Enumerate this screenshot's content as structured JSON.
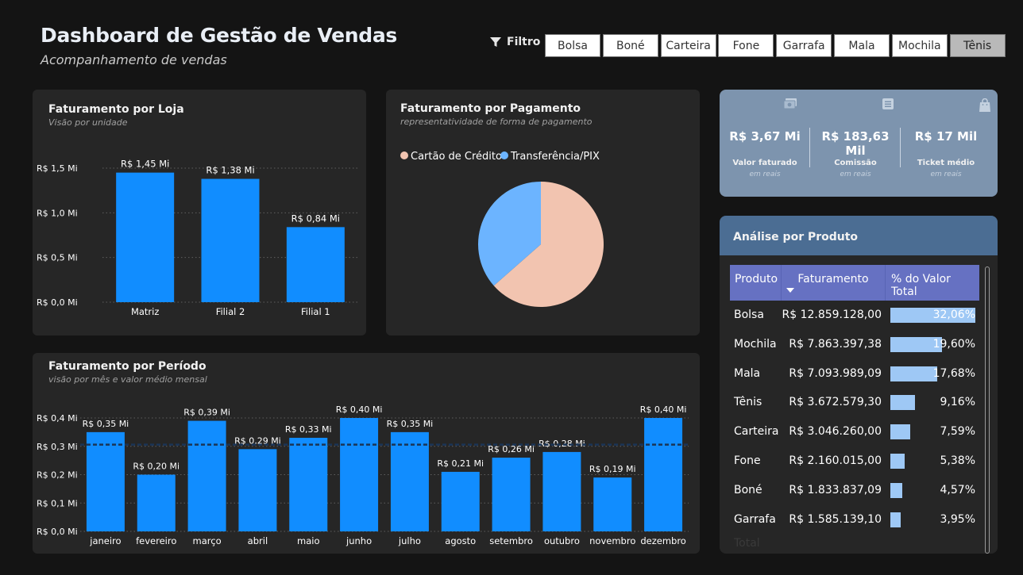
{
  "header": {
    "title": "Dashboard de Gestão de Vendas",
    "subtitle": "Acompanhamento de vendas"
  },
  "filter": {
    "label": "Filtro",
    "icon": "funnel-icon",
    "options": [
      "Bolsa",
      "Boné",
      "Carteira",
      "Fone",
      "Garrafa",
      "Mala",
      "Mochila",
      "Tênis"
    ],
    "selected": "Tênis"
  },
  "colors": {
    "bar": "#118dff",
    "card_bg": "#262626",
    "kpi_bg": "#7d94ae",
    "table_header": "#6671c2",
    "pie_credit": "#f2c4b0",
    "pie_pix": "#6cb4ff"
  },
  "store_chart": {
    "title": "Faturamento por Loja",
    "subtitle": "Visão por unidade",
    "chart_data": {
      "type": "bar",
      "categories": [
        "Matriz",
        "Filial 2",
        "Filial 1"
      ],
      "values": [
        1.45,
        1.38,
        0.84
      ],
      "data_labels": [
        "R$ 1,45 Mi",
        "R$ 1,38 Mi",
        "R$ 0,84 Mi"
      ],
      "yticks": [
        "R$ 0,0 Mi",
        "R$ 0,5 Mi",
        "R$ 1,0 Mi",
        "R$ 1,5 Mi"
      ],
      "ytick_values": [
        0,
        0.5,
        1.0,
        1.5
      ],
      "ylim": [
        0,
        1.5
      ],
      "grid": true
    }
  },
  "payment_chart": {
    "title": "Faturamento por Pagamento",
    "subtitle": "representatividade de forma de pagamento",
    "chart_data": {
      "type": "pie",
      "labels": [
        "Cartão de Crédito",
        "Transferência/PIX"
      ],
      "values": [
        63.5,
        36.5
      ],
      "legend": "top-left"
    }
  },
  "period_chart": {
    "title": "Faturamento por Período",
    "subtitle": "visão por mês e valor médio mensal",
    "chart_data": {
      "type": "bar",
      "categories": [
        "janeiro",
        "fevereiro",
        "março",
        "abril",
        "maio",
        "junho",
        "julho",
        "agosto",
        "setembro",
        "outubro",
        "novembro",
        "dezembro"
      ],
      "values": [
        0.35,
        0.2,
        0.39,
        0.29,
        0.33,
        0.4,
        0.35,
        0.21,
        0.26,
        0.28,
        0.19,
        0.4
      ],
      "data_labels": [
        "R$ 0,35 Mi",
        "R$ 0,20 Mi",
        "R$ 0,39 Mi",
        "R$ 0,29 Mi",
        "R$ 0,33 Mi",
        "R$ 0,40 Mi",
        "R$ 0,35 Mi",
        "R$ 0,21 Mi",
        "R$ 0,26 Mi",
        "R$ 0,28 Mi",
        "R$ 0,19 Mi",
        "R$ 0,40 Mi"
      ],
      "yticks": [
        "R$ 0,0 Mi",
        "R$ 0,1 Mi",
        "R$ 0,2 Mi",
        "R$ 0,3 Mi",
        "R$ 0,4 Mi"
      ],
      "ytick_values": [
        0,
        0.1,
        0.2,
        0.3,
        0.4
      ],
      "ylim": [
        0,
        0.4
      ],
      "average_line": 0.306,
      "grid": true
    }
  },
  "kpis": [
    {
      "value": "R$ 3,67 Mi",
      "label": "Valor faturado",
      "unit": "em reais",
      "icon": "money-icon"
    },
    {
      "value": "R$ 183,63 Mil",
      "label": "Comissão",
      "unit": "em reais",
      "icon": "receipt-icon"
    },
    {
      "value": "R$ 17 Mil",
      "label": "Ticket médio",
      "unit": "em reais",
      "icon": "shopping-bag-icon"
    }
  ],
  "product_table": {
    "title": "Análise por Produto",
    "columns": [
      "Produto",
      "Faturamento",
      "% do Valor Total"
    ],
    "sort_column": "Faturamento",
    "sort_direction": "descending",
    "rows": [
      {
        "product": "Bolsa",
        "revenue": "R$ 12.859.128,00",
        "percent": "32,06%",
        "share": 32.06
      },
      {
        "product": "Mochila",
        "revenue": "R$ 7.863.397,38",
        "percent": "19,60%",
        "share": 19.6
      },
      {
        "product": "Mala",
        "revenue": "R$ 7.093.989,09",
        "percent": "17,68%",
        "share": 17.68
      },
      {
        "product": "Tênis",
        "revenue": "R$ 3.672.579,30",
        "percent": "9,16%",
        "share": 9.16
      },
      {
        "product": "Carteira",
        "revenue": "R$ 3.046.260,00",
        "percent": "7,59%",
        "share": 7.59
      },
      {
        "product": "Fone",
        "revenue": "R$ 2.160.015,00",
        "percent": "5,38%",
        "share": 5.38
      },
      {
        "product": "Boné",
        "revenue": "R$ 1.833.837,09",
        "percent": "4,57%",
        "share": 4.57
      },
      {
        "product": "Garrafa",
        "revenue": "R$ 1.585.139,10",
        "percent": "3,95%",
        "share": 3.95
      }
    ],
    "total_label": "Total"
  }
}
